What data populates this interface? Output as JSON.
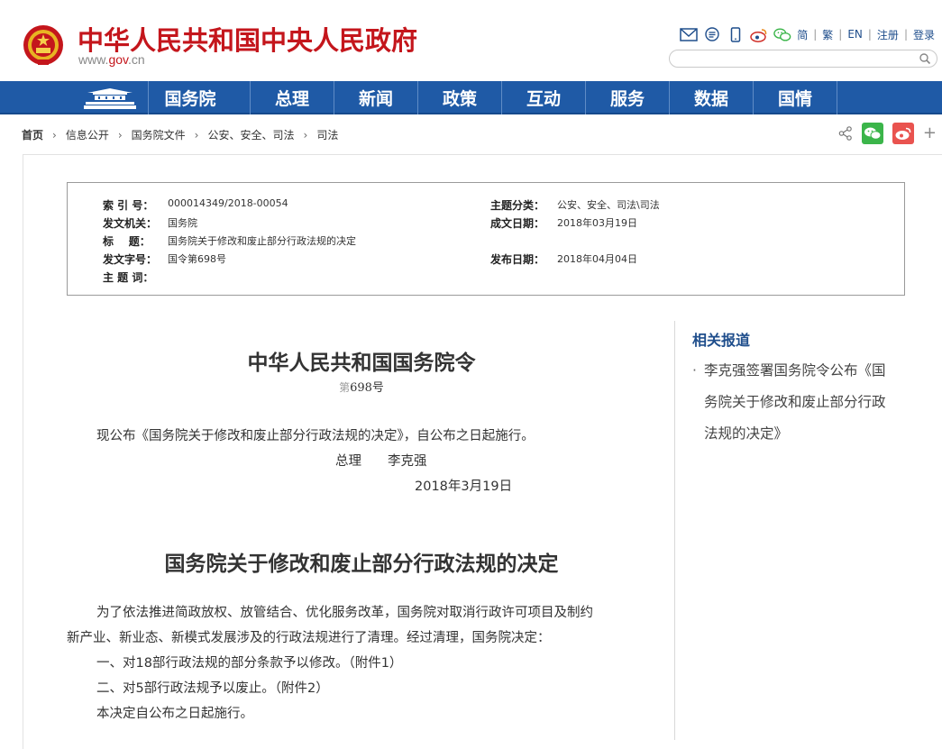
{
  "header": {
    "site_title": "中华人民共和国中央人民政府",
    "domain_pre": "www.",
    "domain_mid": "gov",
    "domain_post": ".cn",
    "search_placeholder": "",
    "links": {
      "simplified": "简",
      "traditional": "繁",
      "english": "EN",
      "register": "注册",
      "login": "登录"
    }
  },
  "nav": {
    "items": [
      "国务院",
      "总理",
      "新闻",
      "政策",
      "互动",
      "服务",
      "数据",
      "国情"
    ]
  },
  "breadcrumb": [
    "首页",
    "信息公开",
    "国务院文件",
    "公安、安全、司法",
    "司法"
  ],
  "info": {
    "index_label": "索 引 号：",
    "index_value": "000014349/2018-00054",
    "topic_label": "主题分类：",
    "topic_value": "公安、安全、司法\\司法",
    "issuer_label": "发文机关：",
    "issuer_value": "国务院",
    "date_written_label": "成文日期：",
    "date_written_value": "2018年03月19日",
    "title_label": "标    题：",
    "title_value": "国务院关于修改和废止部分行政法规的决定",
    "docno_label": "发文字号：",
    "docno_value": "国令第698号",
    "publish_label": "发布日期：",
    "publish_value": "2018年04月04日",
    "keywords_label": "主 题 词："
  },
  "article": {
    "order_title": "中华人民共和国国务院令",
    "order_num_pre": "第",
    "order_num": "698号",
    "promulgation": "现公布《国务院关于修改和废止部分行政法规的决定》，自公布之日起施行。",
    "signer": "总理　　李克强",
    "sign_date": "2018年3月19日",
    "doc_title": "国务院关于修改和废止部分行政法规的决定",
    "para1_line1": "为了依法推进简政放权、放管结合、优化服务改革，国务院对取消行政许可项目及制约",
    "para1_line2": "新产业、新业态、新模式发展涉及的行政法规进行了清理。经过清理，国务院决定：",
    "item1": "一、对18部行政法规的部分条款予以修改。（附件1）",
    "item2": "二、对5部行政法规予以废止。（附件2）",
    "closing": "本决定自公布之日起施行。"
  },
  "sidebar": {
    "title": "相关报道",
    "items": [
      "李克强签署国务院令公布《国务院关于修改和废止部分行政法规的决定》"
    ],
    "item_line1": "李克强签署国务院令公布《国",
    "item_line2": "务院关于修改和废止部分行政",
    "item_line3": "法规的决定》"
  },
  "colors": {
    "brand_red": "#c4161c",
    "nav_blue": "#1f5aa6",
    "link_blue": "#1f4e8c",
    "wechat_green": "#3bb54a",
    "weibo_red": "#e9534f"
  }
}
